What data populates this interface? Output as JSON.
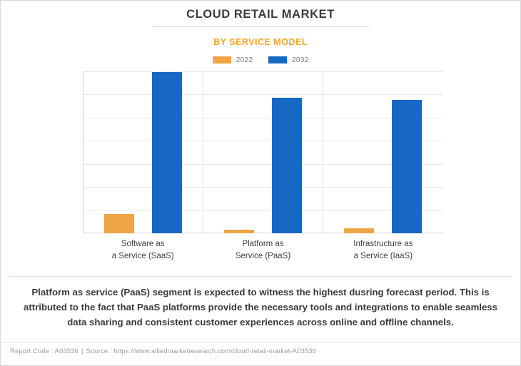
{
  "header": {
    "title": "CLOUD RETAIL MARKET",
    "subtitle": "BY SERVICE MODEL"
  },
  "legend": {
    "items": [
      {
        "label": "2022",
        "color": "#efa445"
      },
      {
        "label": "2032",
        "color": "#1668c4"
      }
    ]
  },
  "caption": "Platform as service (PaaS) segment is expected to witness the highest dusring forecast period. This is attributed to the fact that PaaS platforms provide the necessary tools and integrations to enable seamless data sharing and consistent customer experiences across online and offline channels.",
  "footer": {
    "report_code_label": "Report Code : A03536",
    "separator": "|",
    "source_label": "Source : https://www.alliedmarketresearch.com/cloud-retail-market-A03536"
  },
  "chart_data": {
    "type": "bar",
    "title": "CLOUD RETAIL MARKET",
    "subtitle": "BY SERVICE MODEL",
    "xlabel": "",
    "ylabel": "",
    "grid": true,
    "legend_position": "top-center",
    "ylim": [
      0,
      7
    ],
    "ytick_labels": [],
    "categories": [
      [
        "Software as",
        "a Service (SaaS)"
      ],
      [
        "Platform as",
        "Service (PaaS)"
      ],
      [
        "Infrastructure as",
        "a Service (IaaS)"
      ]
    ],
    "category_names": [
      "Software as a Service (SaaS)",
      "Platform as Service (PaaS)",
      "Infrastructure as a Service (IaaS)"
    ],
    "series": [
      {
        "name": "2022",
        "color": "#efa445",
        "values": [
          0.84,
          0.15,
          0.22
        ]
      },
      {
        "name": "2032",
        "color": "#1668c4",
        "values": [
          6.98,
          5.86,
          5.77
        ]
      }
    ]
  }
}
